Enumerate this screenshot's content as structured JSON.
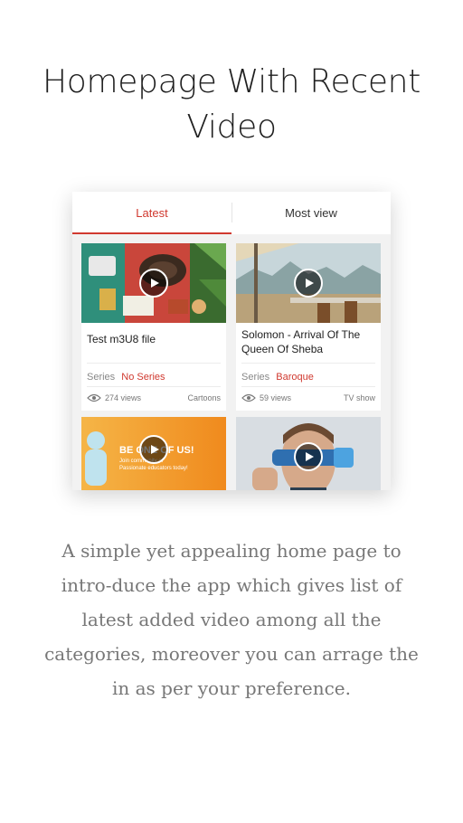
{
  "headline": "Homepage With Recent Video",
  "tabs": [
    {
      "label": "Latest",
      "active": true
    },
    {
      "label": "Most view",
      "active": false
    }
  ],
  "accent_color": "#d0392f",
  "videos": [
    {
      "title": "Test m3U8 file",
      "series_label": "Series",
      "series_value": "No Series",
      "views": "274 views",
      "category": "Cartoons",
      "thumbnail": "flatlay-hat-camera"
    },
    {
      "title": "Solomon - Arrival Of The Queen Of Sheba",
      "series_label": "Series",
      "series_value": "Baroque",
      "views": "59 views",
      "category": "TV show",
      "thumbnail": "ship-deck-bay"
    },
    {
      "thumbnail": "be-one-of-us-banner",
      "banner_title": "BE ONE OF US!",
      "banner_text": "Join community of Passionate educators today!"
    },
    {
      "thumbnail": "man-vr-glasses"
    }
  ],
  "description": "A simple yet appealing home page to intro-duce the app which gives list of latest added video among all the categories, moreover you can arrage the in as per your preference."
}
